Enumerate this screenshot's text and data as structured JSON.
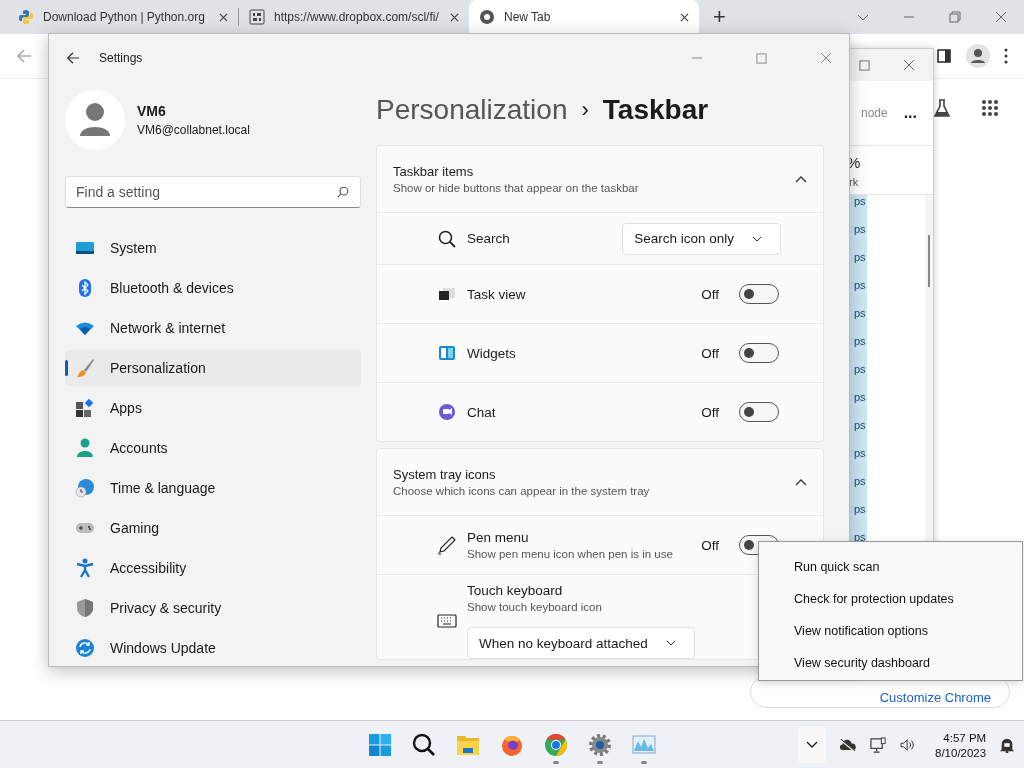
{
  "browser": {
    "tabs": [
      {
        "title": "Download Python | Python.org",
        "selected": false
      },
      {
        "title": "https://www.dropbox.com/scl/fi/",
        "selected": false
      },
      {
        "title": "New Tab",
        "selected": true
      }
    ],
    "new_tab_button": "+",
    "customize_button": "Customize Chrome"
  },
  "background_window": {
    "toolbar_text": "node",
    "more_button": "...",
    "column_header": "%",
    "column_subheader": "rk",
    "cells": [
      "ps",
      "ps",
      "ps",
      "ps",
      "ps",
      "ps",
      "ps",
      "ps",
      "ps",
      "ps",
      "ps",
      "ps",
      "ps"
    ]
  },
  "settings": {
    "title": "Settings",
    "user": {
      "name": "VM6",
      "email": "VM6@collabnet.local"
    },
    "search": {
      "placeholder": "Find a setting"
    },
    "nav": [
      {
        "label": "System",
        "selected": false
      },
      {
        "label": "Bluetooth & devices",
        "selected": false
      },
      {
        "label": "Network & internet",
        "selected": false
      },
      {
        "label": "Personalization",
        "selected": true
      },
      {
        "label": "Apps",
        "selected": false
      },
      {
        "label": "Accounts",
        "selected": false
      },
      {
        "label": "Time & language",
        "selected": false
      },
      {
        "label": "Gaming",
        "selected": false
      },
      {
        "label": "Accessibility",
        "selected": false
      },
      {
        "label": "Privacy & security",
        "selected": false
      },
      {
        "label": "Windows Update",
        "selected": false
      }
    ],
    "breadcrumb": {
      "parent": "Personalization",
      "separator": "›",
      "current": "Taskbar"
    },
    "sections": [
      {
        "title": "Taskbar items",
        "subtitle": "Show or hide buttons that appear on the taskbar",
        "expanded": true,
        "rows": [
          {
            "kind": "dropdown",
            "label": "Search",
            "value": "Search icon only"
          },
          {
            "kind": "toggle",
            "label": "Task view",
            "on": false,
            "state_label": "Off"
          },
          {
            "kind": "toggle",
            "label": "Widgets",
            "on": false,
            "state_label": "Off"
          },
          {
            "kind": "toggle",
            "label": "Chat",
            "on": false,
            "state_label": "Off"
          }
        ]
      },
      {
        "title": "System tray icons",
        "subtitle": "Choose which icons can appear in the system tray",
        "expanded": true,
        "rows": [
          {
            "kind": "toggle",
            "label": "Pen menu",
            "description": "Show pen menu icon when pen is in use",
            "on": false,
            "state_label": "Off"
          },
          {
            "kind": "dropdown_below",
            "label": "Touch keyboard",
            "description": "Show touch keyboard icon",
            "value": "When no keyboard attached"
          }
        ]
      }
    ]
  },
  "context_menu": {
    "items": [
      "Run quick scan",
      "Check for protection updates",
      "View notification options",
      "View security dashboard"
    ]
  },
  "taskbar": {
    "apps": [
      {
        "running": false
      },
      {
        "running": false
      },
      {
        "running": false
      },
      {
        "running": false
      },
      {
        "running": true
      },
      {
        "running": true
      },
      {
        "running": true
      }
    ],
    "time": "4:57 PM",
    "date": "8/10/2023"
  }
}
